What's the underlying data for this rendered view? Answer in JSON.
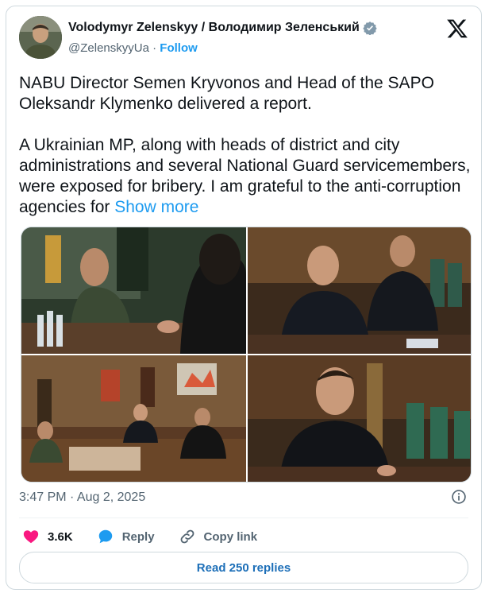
{
  "author": {
    "name": "Volodymyr Zelenskyy / Володимир Зеленський",
    "handle": "@ZelenskyyUa",
    "separator": "·",
    "follow_label": "Follow",
    "avatar_icon": "avatar-photo",
    "verified_icon": "verified-badge-icon"
  },
  "brand": {
    "logo_icon": "x-logo-icon"
  },
  "tweet": {
    "paragraph1": "NABU Director Semen Kryvonos and Head of the SAPO Oleksandr Klymenko delivered a report.",
    "paragraph2": "A Ukrainian MP, along with heads of district and city administrations and several National Guard servicemembers, were exposed for bribery. I am grateful to the anti-corruption agencies for",
    "show_more_label": "Show more"
  },
  "media": {
    "photos": [
      {
        "icon": "photo-meeting-closeup"
      },
      {
        "icon": "photo-two-officials-seated"
      },
      {
        "icon": "photo-office-wide"
      },
      {
        "icon": "photo-official-portrait"
      }
    ]
  },
  "meta": {
    "timestamp": "3:47 PM · Aug 2, 2025",
    "info_icon": "info-icon"
  },
  "actions": {
    "likes_count": "3.6K",
    "reply_label": "Reply",
    "copy_link_label": "Copy link",
    "read_replies_label": "Read 250 replies"
  },
  "colors": {
    "accent": "#1d9bf0",
    "like": "#f91880",
    "text": "#0f1419",
    "muted": "#536471",
    "border": "#cfd9de"
  }
}
